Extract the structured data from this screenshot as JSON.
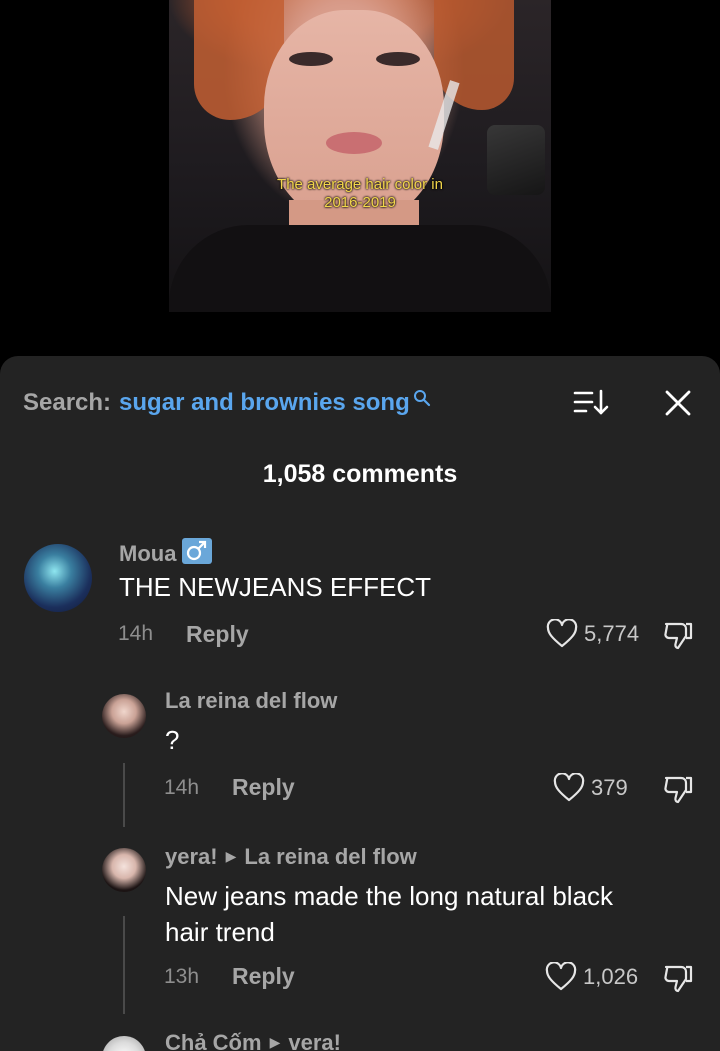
{
  "video": {
    "caption_line1": "The average hair color in",
    "caption_line2": "2016-2019"
  },
  "panel": {
    "search_label": "Search:",
    "search_query": "sugar and brownies song",
    "comments_count": "1,058 comments"
  },
  "comments": [
    {
      "user": "Moua",
      "text": "THE NEWJEANS EFFECT",
      "time": "14h",
      "reply_label": "Reply",
      "likes": "5,774"
    },
    {
      "user": "La reina del flow",
      "text": "?",
      "time": "14h",
      "reply_label": "Reply",
      "likes": "379"
    },
    {
      "user": "yera!",
      "reply_to": "La reina del flow",
      "text_line1": "New jeans made the long natural black",
      "text_line2": "hair trend",
      "time": "13h",
      "reply_label": "Reply",
      "likes": "1,026"
    },
    {
      "user": "Chả Cốm",
      "reply_to": "vera!"
    }
  ],
  "colors": {
    "accent_link": "#5aa6ee",
    "panel_bg": "#232323",
    "caption": "#f2d64b"
  },
  "icons": [
    "search-icon",
    "sort-icon",
    "close-icon",
    "heart-icon",
    "dislike-icon",
    "male-sign-icon",
    "reply-arrow-icon"
  ]
}
